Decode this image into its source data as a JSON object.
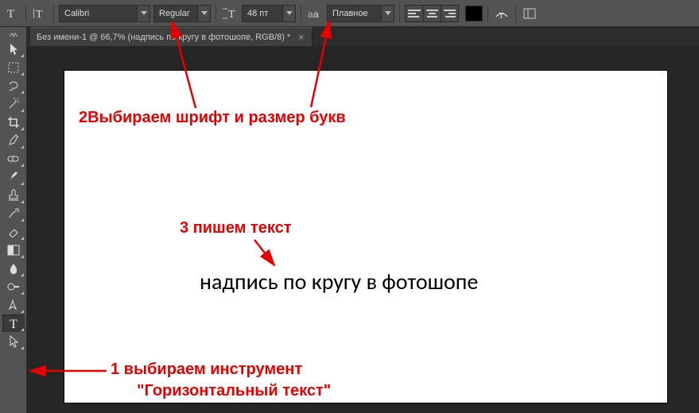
{
  "options": {
    "font_family": "Calibri",
    "font_style": "Regular",
    "font_size": "48 пт",
    "antialias": "Плавное"
  },
  "document": {
    "tab_title": "Без имени-1 @ 66,7% (надпись по кругу в фотошопе, RGB/8) *"
  },
  "canvas_text": "надпись по кругу в фотошопе",
  "annotations": {
    "step1_line1": "1 выбираем инструмент",
    "step1_line2": "\"Горизонтальный текст\"",
    "step2": "2Выбираем шрифт и размер букв",
    "step3": "3 пишем текст"
  }
}
